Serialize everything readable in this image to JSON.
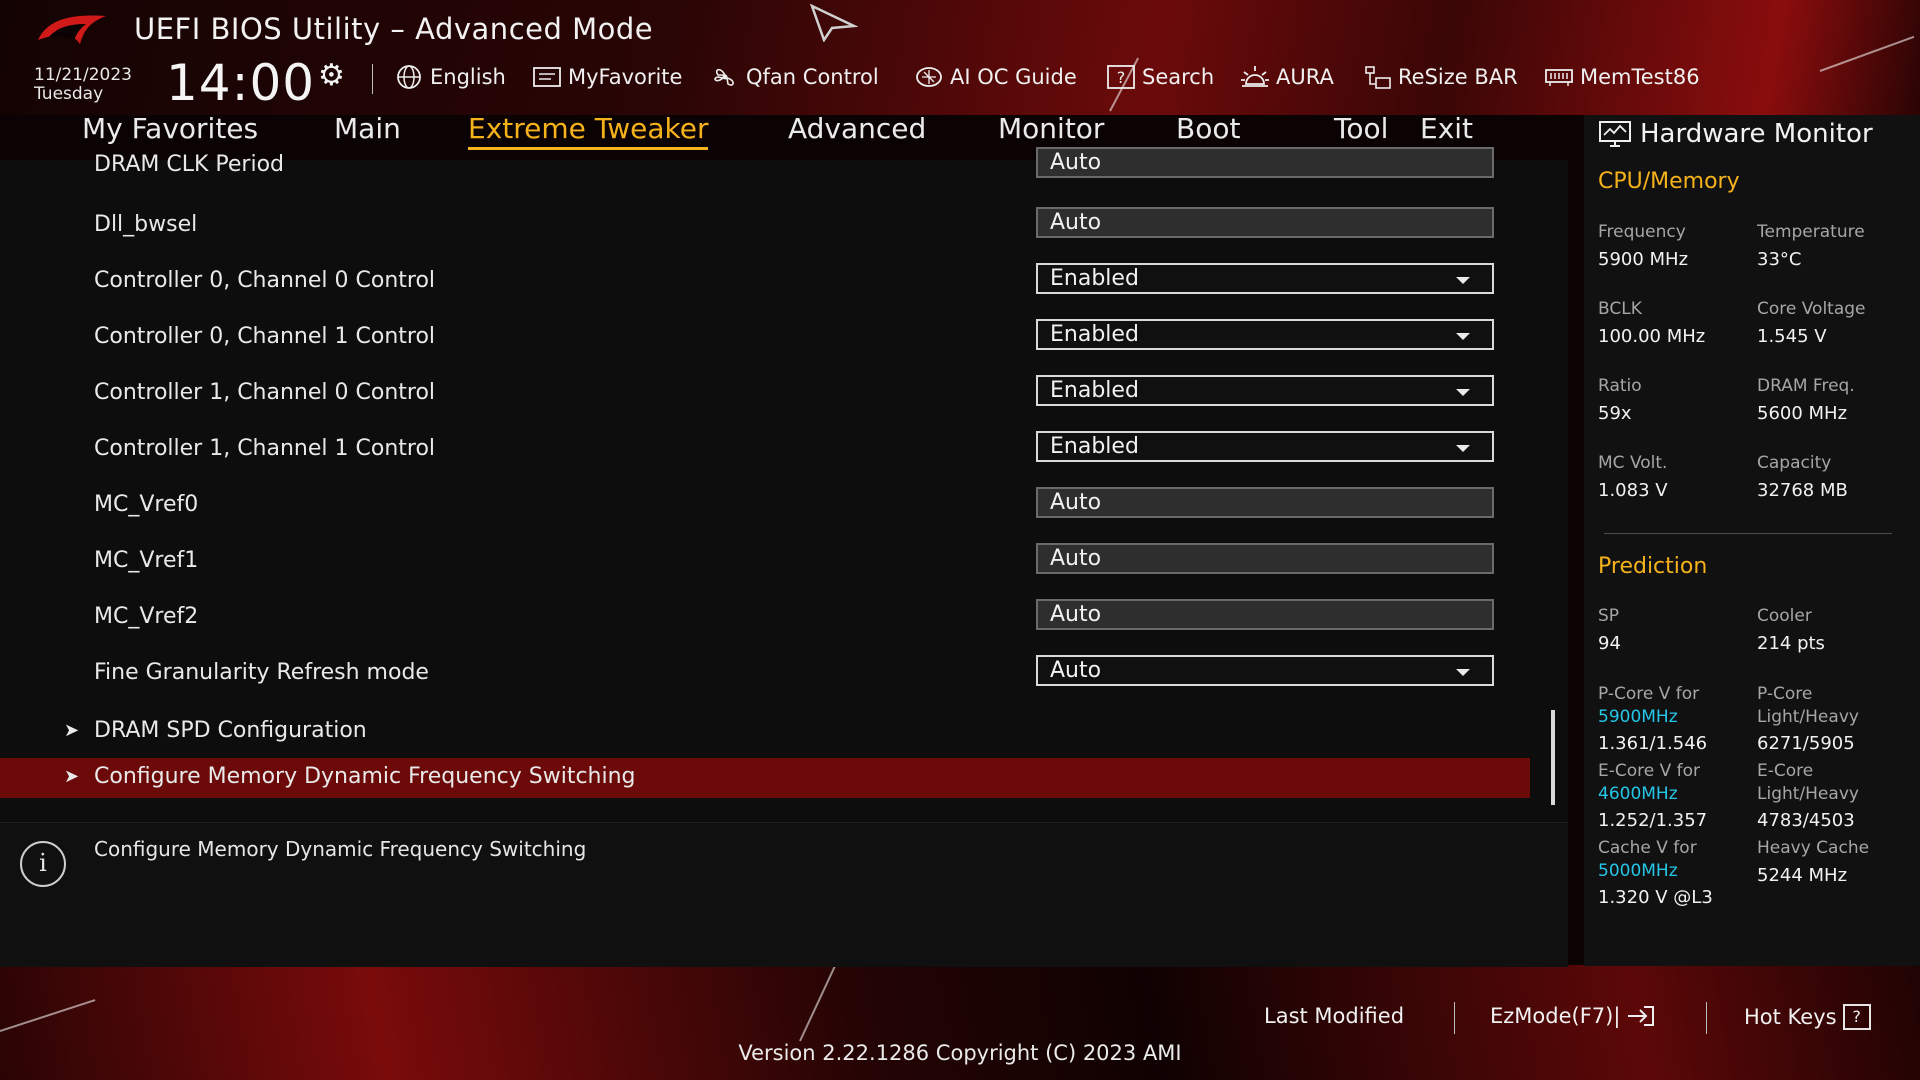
{
  "header": {
    "title": "UEFI BIOS Utility – Advanced Mode",
    "date": "11/21/2023",
    "day": "Tuesday",
    "time": "14:00",
    "tools": [
      {
        "label": "English",
        "icon": "globe-icon"
      },
      {
        "label": "MyFavorite",
        "icon": "favorite-icon"
      },
      {
        "label": "Qfan Control",
        "icon": "fan-icon"
      },
      {
        "label": "AI OC Guide",
        "icon": "ai-guide-icon"
      },
      {
        "label": "Search",
        "icon": "search-icon"
      },
      {
        "label": "AURA",
        "icon": "aura-icon"
      },
      {
        "label": "ReSize BAR",
        "icon": "resize-bar-icon"
      },
      {
        "label": "MemTest86",
        "icon": "memtest-icon"
      }
    ]
  },
  "tabs": [
    {
      "label": "My Favorites",
      "active": false
    },
    {
      "label": "Main",
      "active": false
    },
    {
      "label": "Extreme Tweaker",
      "active": true
    },
    {
      "label": "Advanced",
      "active": false
    },
    {
      "label": "Monitor",
      "active": false
    },
    {
      "label": "Boot",
      "active": false
    },
    {
      "label": "Tool",
      "active": false
    },
    {
      "label": "Exit",
      "active": false
    }
  ],
  "settings": {
    "rows": [
      {
        "label": "DRAM CLK Period",
        "value": "Auto",
        "type": "text"
      },
      {
        "label": "Dll_bwsel",
        "value": "Auto",
        "type": "text"
      },
      {
        "label": "Controller 0, Channel 0 Control",
        "value": "Enabled",
        "type": "select"
      },
      {
        "label": "Controller 0, Channel 1 Control",
        "value": "Enabled",
        "type": "select"
      },
      {
        "label": "Controller 1, Channel 0 Control",
        "value": "Enabled",
        "type": "select"
      },
      {
        "label": "Controller 1, Channel 1 Control",
        "value": "Enabled",
        "type": "select"
      },
      {
        "label": "MC_Vref0",
        "value": "Auto",
        "type": "text"
      },
      {
        "label": "MC_Vref1",
        "value": "Auto",
        "type": "text"
      },
      {
        "label": "MC_Vref2",
        "value": "Auto",
        "type": "text"
      },
      {
        "label": "Fine Granularity Refresh mode",
        "value": "Auto",
        "type": "select"
      }
    ],
    "submenus": [
      {
        "label": "DRAM SPD Configuration",
        "selected": false
      },
      {
        "label": "Configure Memory Dynamic Frequency Switching",
        "selected": true
      }
    ],
    "help_text": "Configure Memory Dynamic Frequency Switching"
  },
  "hardware_monitor": {
    "title": "Hardware Monitor",
    "cpu_memory_title": "CPU/Memory",
    "cpu_memory": [
      {
        "label": "Frequency",
        "value": "5900 MHz"
      },
      {
        "label": "Temperature",
        "value": "33°C"
      },
      {
        "label": "BCLK",
        "value": "100.00 MHz"
      },
      {
        "label": "Core Voltage",
        "value": "1.545 V"
      },
      {
        "label": "Ratio",
        "value": "59x"
      },
      {
        "label": "DRAM Freq.",
        "value": "5600 MHz"
      },
      {
        "label": "MC Volt.",
        "value": "1.083 V"
      },
      {
        "label": "Capacity",
        "value": "32768 MB"
      }
    ],
    "prediction_title": "Prediction",
    "prediction": {
      "sp_label": "SP",
      "sp_value": "94",
      "cooler_label": "Cooler",
      "cooler_value": "214 pts",
      "pcore_v_label": "P-Core V for",
      "pcore_v_freq": "5900MHz",
      "pcore_v_value": "1.361/1.546",
      "pcore_lh_label1": "P-Core",
      "pcore_lh_label2": "Light/Heavy",
      "pcore_lh_value": "6271/5905",
      "ecore_v_label": "E-Core V for",
      "ecore_v_freq": "4600MHz",
      "ecore_v_value": "1.252/1.357",
      "ecore_lh_label1": "E-Core",
      "ecore_lh_label2": "Light/Heavy",
      "ecore_lh_value": "4783/4503",
      "cache_v_label": "Cache V for",
      "cache_v_freq": "5000MHz",
      "cache_v_value": "1.320 V @L3",
      "heavy_cache_label": "Heavy Cache",
      "heavy_cache_value": "5244 MHz"
    }
  },
  "footer": {
    "last_modified": "Last Modified",
    "ezmode": "EzMode(F7)|",
    "hotkeys": "Hot Keys",
    "hotkeys_key": "?",
    "version": "Version 2.22.1286 Copyright (C) 2023 AMI"
  },
  "colors": {
    "accent": "#f5b21b",
    "selected_row": "#6c0a0a",
    "freq_highlight": "#25c6e8"
  }
}
